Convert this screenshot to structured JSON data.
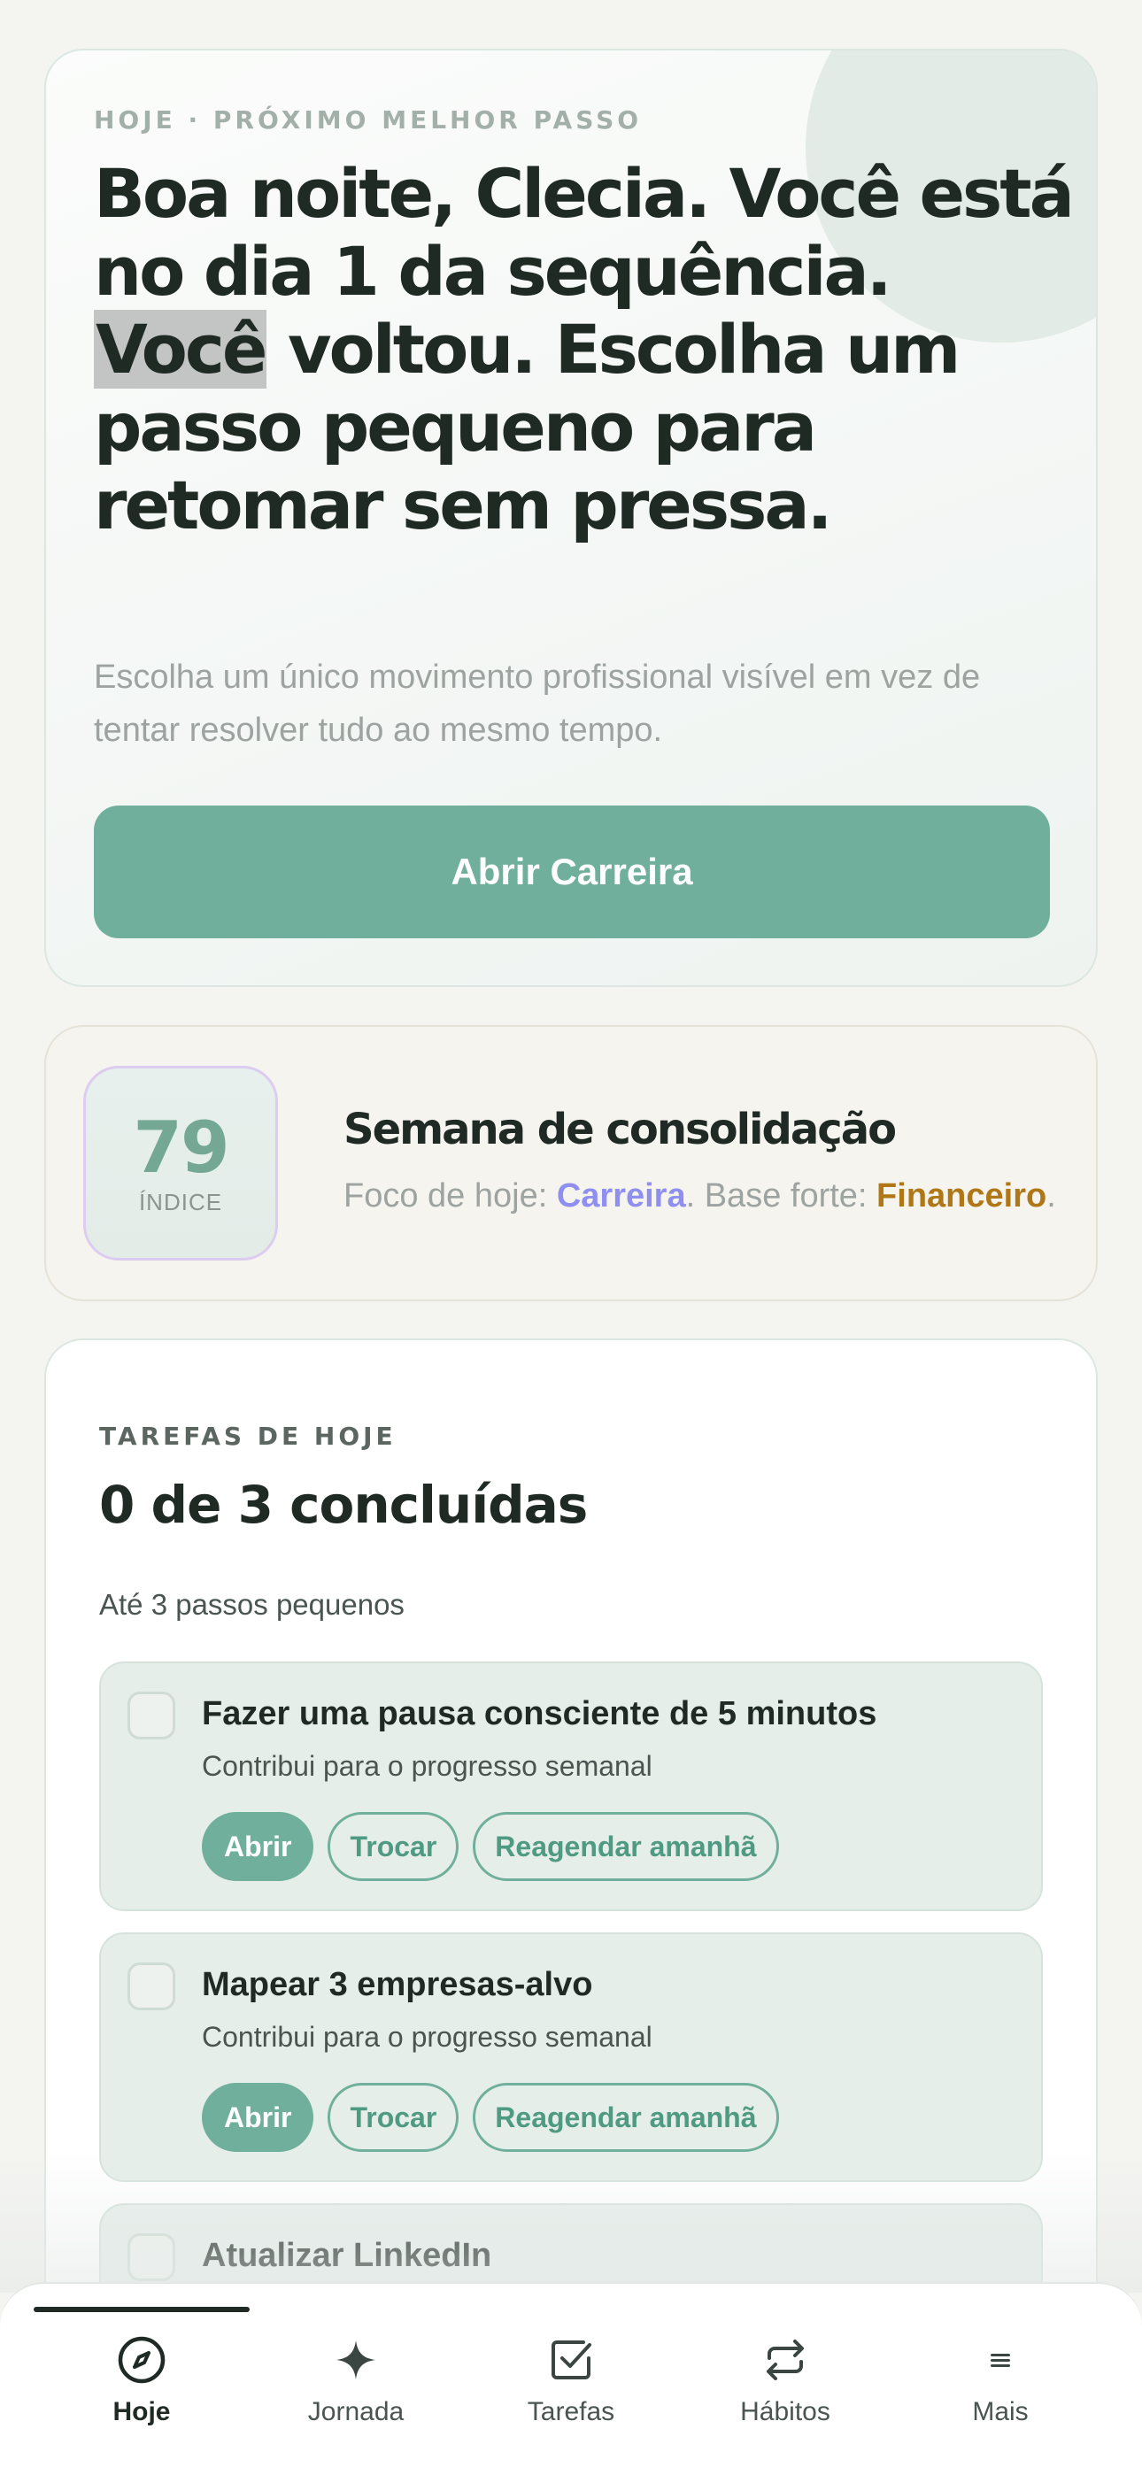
{
  "hero": {
    "eyebrow": "HOJE · PRÓXIMO MELHOR PASSO",
    "headline_before": "Boa noite, Clecia. Você está no dia 1 da sequência. ",
    "headline_highlight": "Você",
    "headline_after": " voltou. Escolha um passo pequeno para retomar sem pressa.",
    "subtitle": "Escolha um único movimento profissional visível em vez de tentar resolver tudo ao mesmo tempo.",
    "button_label": "Abrir Carreira"
  },
  "index": {
    "score": "79",
    "score_label": "ÍNDICE",
    "title": "Semana de consolidação",
    "focus_prefix": "Foco de hoje: ",
    "focus_value": "Carreira",
    "base_prefix": ". Base forte: ",
    "base_value": "Financeiro",
    "suffix": "."
  },
  "tasks": {
    "eyebrow": "TAREFAS DE HOJE",
    "title": "0 de 3 concluídas",
    "subtitle": "Até 3 passos pequenos",
    "items": [
      {
        "title": "Fazer uma pausa consciente de 5 minutos",
        "subtitle": "Contribui para o progresso semanal",
        "open": "Abrir",
        "swap": "Trocar",
        "reschedule": "Reagendar amanhã"
      },
      {
        "title": "Mapear 3 empresas-alvo",
        "subtitle": "Contribui para o progresso semanal",
        "open": "Abrir",
        "swap": "Trocar",
        "reschedule": "Reagendar amanhã"
      },
      {
        "title": "Atualizar LinkedIn"
      }
    ]
  },
  "nav": {
    "items": [
      {
        "label": "Hoje",
        "icon": "compass-icon",
        "active": true
      },
      {
        "label": "Jornada",
        "icon": "sparkle-icon"
      },
      {
        "label": "Tarefas",
        "icon": "checkbox-icon"
      },
      {
        "label": "Hábitos",
        "icon": "repeat-icon"
      },
      {
        "label": "Mais",
        "icon": "menu-icon"
      }
    ]
  },
  "colors": {
    "accent": "#70af9b",
    "focus": "#8e8ff0",
    "base": "#b07716",
    "text": "#1f2a25"
  }
}
